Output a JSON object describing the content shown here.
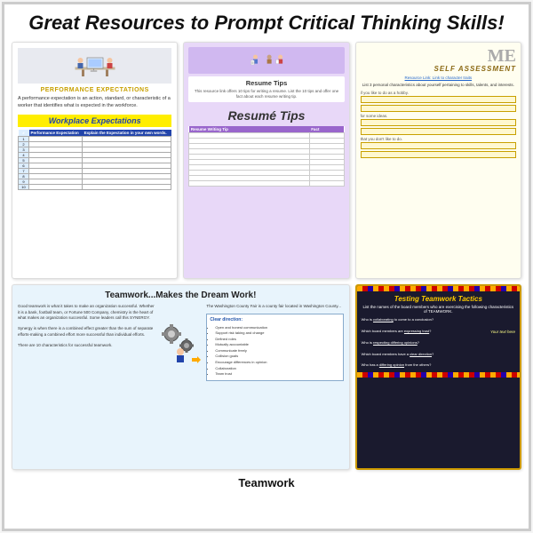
{
  "main_title": "Great Resources to Prompt Critical Thinking Skills!",
  "cards": {
    "perf": {
      "heading": "Performance Expectations",
      "desc": "A performance expectation is an action, standard, or characteristic of a worker that identifies what is expected in the workforce.",
      "yellow_label": "Workplace Expectations",
      "table_header1": "Performance Expectation",
      "table_header2": "Explain the Expectation in your own words.",
      "rows": [
        "1",
        "2",
        "3",
        "4",
        "5",
        "6",
        "7",
        "8",
        "9",
        "10"
      ]
    },
    "resume": {
      "top_desc": "This resource link offers 10 tips for writing a resume. List the 10 tips and offer one fact about each resume writing tip.",
      "title": "Resumé Tips",
      "col1": "Resume Writing Tip",
      "col2": "Fact"
    },
    "self": {
      "me_text": "ME",
      "title": "Self Assessment",
      "link_text": "Resource Link: Link to character traits",
      "desc": "List 3 personal characteristics about yourself pertaining to skills, talents, and interests.",
      "field1_label": "if you like to do as a hobby.",
      "field2_label": "for some ideas.",
      "field3_label": "that you don't like to do."
    },
    "teamwork": {
      "title": "Teamwork...Makes the Dream Work!",
      "left_text": "Good teamwork is what it takes to make an organization successful. Whether it is a bank, football team, or Fortune 500 Company, chemistry is the heart of what makes an organization successful. Some leaders call this SYNERGY.",
      "synergy_text": "Synergy is when there is a combined effect greater than the sum of separate efforts-making a combined effort more successful than individual efforts.",
      "count_text": "There are 10 characteristics for successful teamwork.",
      "right_text": "The Washington County Fair is a county fair located in Washington County...",
      "box_title": "Clear direction:",
      "box_items": [
        "Open and honest communication",
        "Support risk taking and change",
        "Defined roles",
        "Mutually accountable",
        "Communicate freely",
        "Collision goals",
        "Encourage differences in opinion",
        "Collaboration",
        "Team trust"
      ]
    },
    "tactics": {
      "title": "Testing Teamwork Tactics",
      "subtitle": "List the names of the board members who are exercising the following characteristics of TEAMWORK.",
      "q1": "Who is collaborating to come to a conclusion?",
      "q2": "Which board members are expressing trust?",
      "a2": "Your text here",
      "q3": "Who is respecting differing opinions?",
      "q4": "Which board members have a clear direction?",
      "q5": "Who has a differing opinion from the others?"
    }
  },
  "bottom": {
    "teamwork_label": "Teamwork"
  }
}
